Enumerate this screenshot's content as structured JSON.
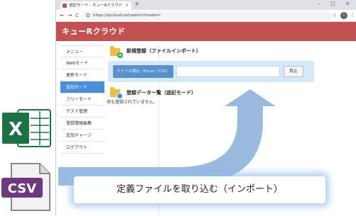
{
  "browser": {
    "tab_title": "追記モード - キューRクラウド",
    "tab_close": "×",
    "new_tab": "+",
    "window_controls": "– □ ×",
    "nav_back": "←",
    "nav_forward": "→",
    "nav_reload": "C",
    "url": "https://qrcloud.net/admin?mode=i",
    "star": "☆",
    "avatar_letter": "i",
    "menu": "⋮"
  },
  "app": {
    "title": "キューRクラウド",
    "brand_color": "#c25151"
  },
  "sidebar": {
    "items": [
      {
        "label": "メニュー"
      },
      {
        "label": "Webモード"
      },
      {
        "label": "更新モード"
      },
      {
        "label": "追記モード",
        "active": true
      },
      {
        "label": "フリーモード"
      },
      {
        "label": "ゲスト管理"
      },
      {
        "label": "登録情報編集"
      },
      {
        "label": "追加チャージ"
      },
      {
        "label": "ログアウト"
      }
    ]
  },
  "main": {
    "new_section_title": "新規登録（ファイルインポート）",
    "file_label": "ファイル読込（Excel／CSV）",
    "file_input_value": "",
    "import_button": "取込",
    "list_section_title": "登録データ一覧（追記モード）",
    "empty_message": "何も登録されていません。"
  },
  "overlay": {
    "caption": "定義ファイルを取り込む（インポート）",
    "excel_icon": "excel-icon",
    "csv_icon": "csv-file-icon",
    "csv_text": "CSV",
    "excel_text": "X",
    "arrow_color": "#8fb3dc"
  }
}
